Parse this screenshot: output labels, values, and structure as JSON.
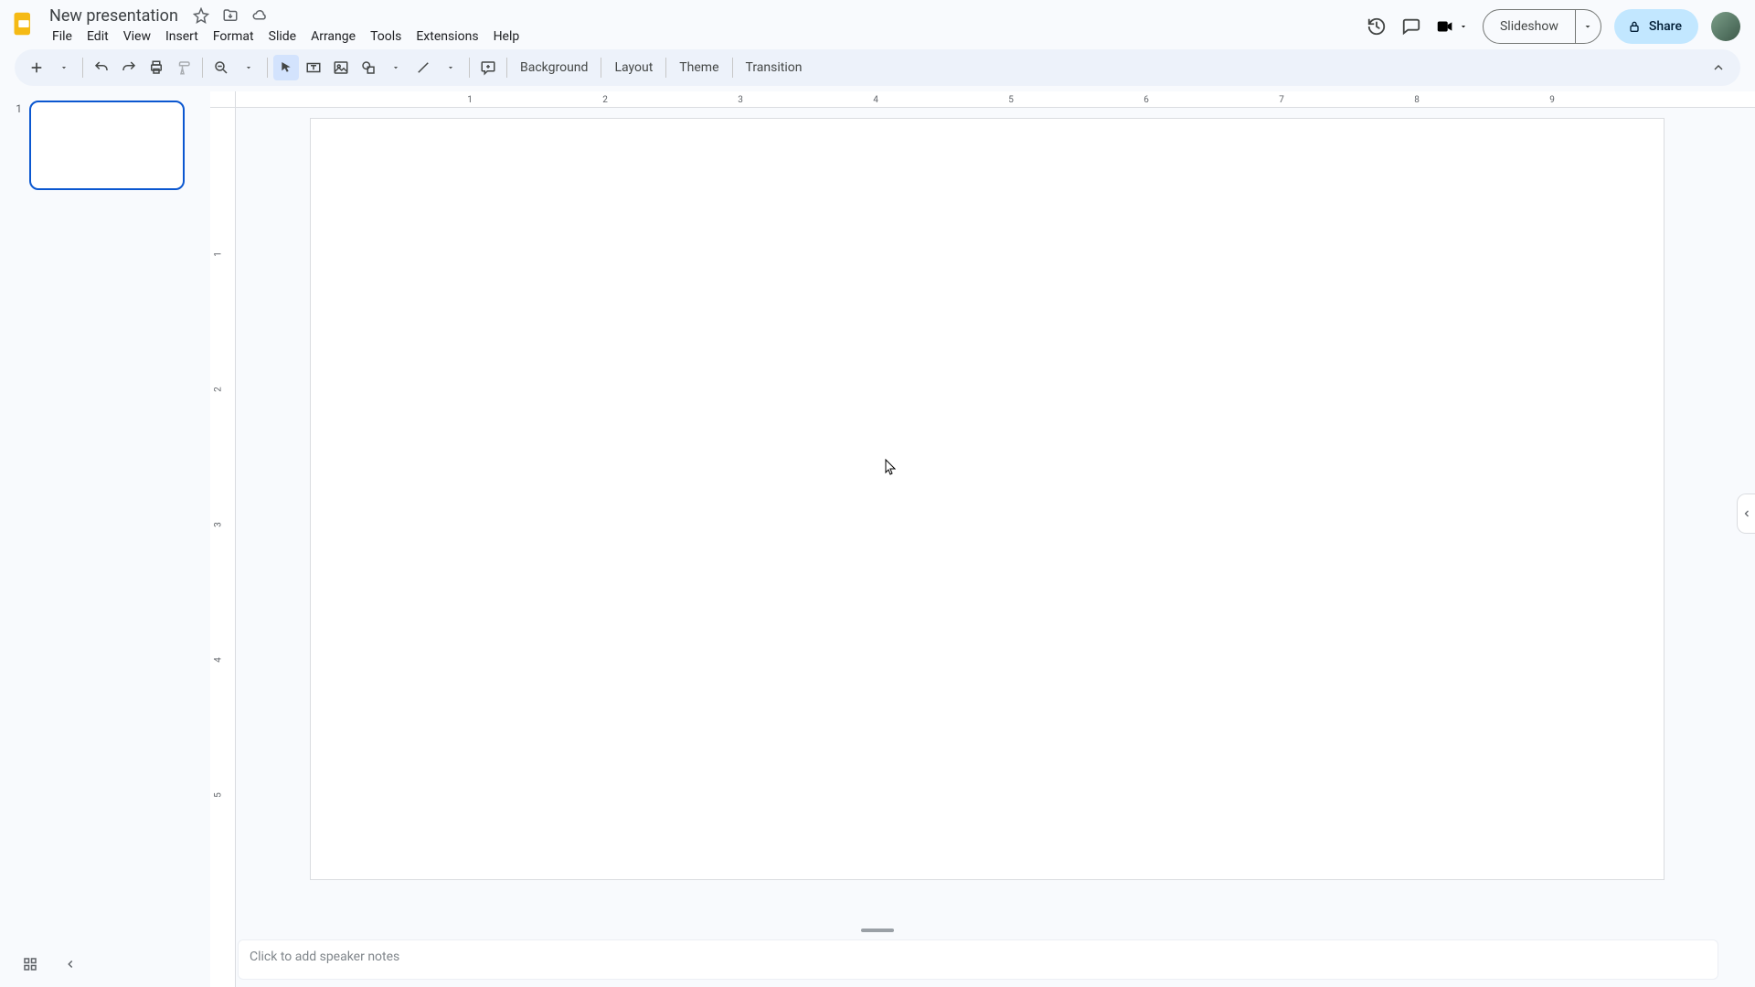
{
  "header": {
    "doc_title": "New presentation",
    "menus": [
      "File",
      "Edit",
      "View",
      "Insert",
      "Format",
      "Slide",
      "Arrange",
      "Tools",
      "Extensions",
      "Help"
    ],
    "slideshow_label": "Slideshow",
    "share_label": "Share"
  },
  "toolbar": {
    "text_buttons": [
      "Background",
      "Layout",
      "Theme",
      "Transition"
    ]
  },
  "filmstrip": {
    "slides": [
      {
        "number": "1"
      }
    ]
  },
  "ruler": {
    "h_labels": [
      "1",
      "2",
      "3",
      "4",
      "5",
      "6",
      "7",
      "8",
      "9"
    ],
    "v_labels": [
      "1",
      "2",
      "3",
      "4",
      "5"
    ]
  },
  "speaker_notes": {
    "placeholder": "Click to add speaker notes"
  }
}
